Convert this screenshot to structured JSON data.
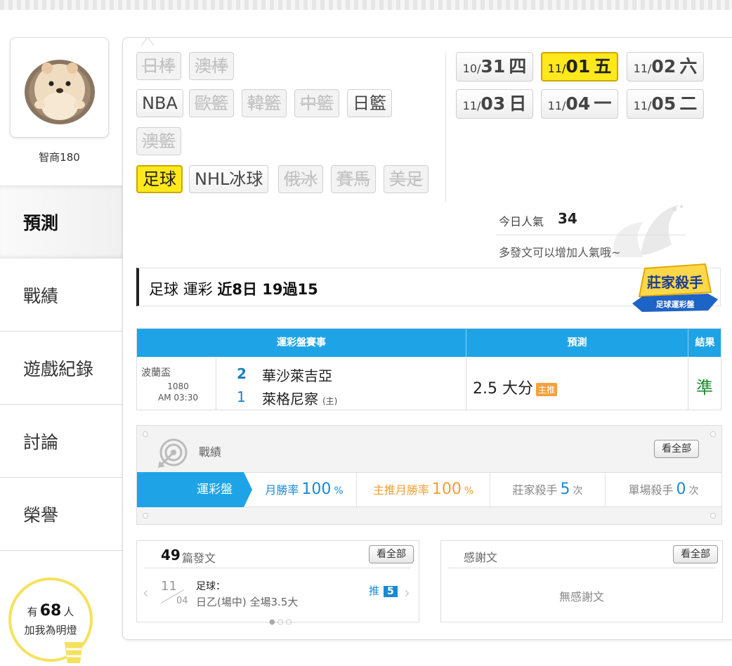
{
  "user": {
    "name": "智商180"
  },
  "side_nav": {
    "items": [
      {
        "label": "預測",
        "active": true
      },
      {
        "label": "戰績",
        "active": false
      },
      {
        "label": "遊戲紀錄",
        "active": false
      },
      {
        "label": "討論",
        "active": false
      },
      {
        "label": "榮譽",
        "active": false
      }
    ]
  },
  "fans": {
    "prefix": "有",
    "count": "68",
    "suffix": "人",
    "cta": "加我為明燈"
  },
  "sports": {
    "items": [
      {
        "label": "日棒",
        "state": "disabled"
      },
      {
        "label": "澳棒",
        "state": "disabled"
      },
      {
        "label": "NBA",
        "state": "enabled"
      },
      {
        "label": "歐籃",
        "state": "disabled"
      },
      {
        "label": "韓籃",
        "state": "disabled"
      },
      {
        "label": "中籃",
        "state": "disabled"
      },
      {
        "label": "日籃",
        "state": "enabled"
      },
      {
        "label": "澳籃",
        "state": "disabled"
      },
      {
        "label": "足球",
        "state": "selected"
      },
      {
        "label": "NHL冰球",
        "state": "enabled"
      },
      {
        "label": "俄冰",
        "state": "disabled"
      },
      {
        "label": "賽馬",
        "state": "disabled"
      },
      {
        "label": "美足",
        "state": "disabled"
      }
    ]
  },
  "dates": {
    "items": [
      {
        "month": "10/",
        "day": "31",
        "weekday": "四",
        "active": false
      },
      {
        "month": "11/",
        "day": "01",
        "weekday": "五",
        "active": true
      },
      {
        "month": "11/",
        "day": "02",
        "weekday": "六",
        "active": false
      },
      {
        "month": "11/",
        "day": "03",
        "weekday": "日",
        "active": false
      },
      {
        "month": "11/",
        "day": "04",
        "weekday": "一",
        "active": false
      },
      {
        "month": "11/",
        "day": "05",
        "weekday": "二",
        "active": false
      }
    ]
  },
  "popularity": {
    "label": "今日人氣",
    "value": "34",
    "hint": "多發文可以增加人氣哦~"
  },
  "headline": {
    "sport": "足球",
    "market": "運彩",
    "record": "近8日 19過15"
  },
  "badge": {
    "title": "莊家殺手",
    "subtitle": "足球運彩盤"
  },
  "prediction_table": {
    "headers": [
      "運彩盤賽事",
      "預測",
      "結果"
    ],
    "rows": [
      {
        "league": "波蘭盃",
        "match_no": "1080",
        "time": "AM 03:30",
        "score_away": "2",
        "team_away": "華沙萊吉亞",
        "score_home": "1",
        "team_home": "萊格尼察",
        "home_tag": "(主)",
        "pick": "2.5 大分",
        "pick_tag": "主推",
        "result": "準"
      }
    ]
  },
  "record": {
    "title": "戰績",
    "view_all": "看全部",
    "tab": "運彩盤",
    "stats": [
      {
        "label": "月勝率",
        "value": "100",
        "unit": "%"
      },
      {
        "label": "主推月勝率",
        "value": "100",
        "unit": "%"
      },
      {
        "label": "莊家殺手",
        "value": "5",
        "unit": "次"
      },
      {
        "label": "單場殺手",
        "value": "0",
        "unit": "次"
      }
    ]
  },
  "posts": {
    "count": "49",
    "label": "篇發文",
    "view_all": "看全部",
    "item": {
      "month": "11",
      "day": "04",
      "category": "足球：",
      "title": "日乙(場中) 全場3.5大",
      "push_label": "推",
      "push_count": "5"
    }
  },
  "thanks": {
    "title": "感謝文",
    "view_all": "看全部",
    "empty": "無感謝文"
  }
}
